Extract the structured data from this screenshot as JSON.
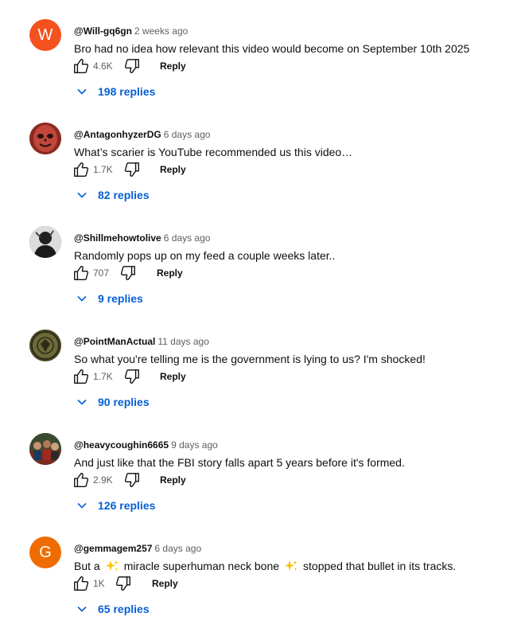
{
  "comments": [
    {
      "avatar": {
        "type": "letter",
        "letter": "W",
        "color": "#f4511e"
      },
      "author": "@Will-gq6gn",
      "time": "2 weeks ago",
      "text_parts": [
        "Bro had no idea how relevant this video would become on September 10th 2025"
      ],
      "likes": "4.6K",
      "reply_label": "Reply",
      "replies": "198 replies"
    },
    {
      "avatar": {
        "type": "image",
        "icon": "skull-mask-avatar",
        "color": "#c0473a"
      },
      "author": "@AntagonhyzerDG",
      "time": "6 days ago",
      "text_parts": [
        "What’s scarier is YouTube recommended us this video…"
      ],
      "likes": "1.7K",
      "reply_label": "Reply",
      "replies": "82 replies"
    },
    {
      "avatar": {
        "type": "image",
        "icon": "bw-portrait-avatar",
        "color": "#3a3a3a"
      },
      "author": "@Shillmehowtolive",
      "time": "6 days ago",
      "text_parts": [
        "Randomly pops up on my feed a couple weeks later.."
      ],
      "likes": "707",
      "reply_label": "Reply",
      "replies": "9 replies"
    },
    {
      "avatar": {
        "type": "image",
        "icon": "emblem-avatar",
        "color": "#6b6a3a"
      },
      "author": "@PointManActual",
      "time": "11 days ago",
      "text_parts": [
        "So what you're telling me is the government is lying to us? I'm shocked!"
      ],
      "likes": "1.7K",
      "reply_label": "Reply",
      "replies": "90 replies"
    },
    {
      "avatar": {
        "type": "image",
        "icon": "group-photo-avatar",
        "color": "#5a3a2e"
      },
      "author": "@heavycoughin6665",
      "time": "9 days ago",
      "text_parts": [
        "And just like that the FBI story falls apart 5 years before it's formed."
      ],
      "likes": "2.9K",
      "reply_label": "Reply",
      "replies": "126 replies"
    },
    {
      "avatar": {
        "type": "letter",
        "letter": "G",
        "color": "#ef6c00"
      },
      "author": "@gemmagem257",
      "time": "6 days ago",
      "text_parts": [
        "But a",
        "miracle superhuman neck bone",
        "stopped that bullet in its tracks."
      ],
      "likes": "1K",
      "reply_label": "Reply",
      "replies": "65 replies"
    }
  ],
  "colors": {
    "link": "#065fd4",
    "muted": "#606060",
    "text": "#0f0f0f"
  }
}
